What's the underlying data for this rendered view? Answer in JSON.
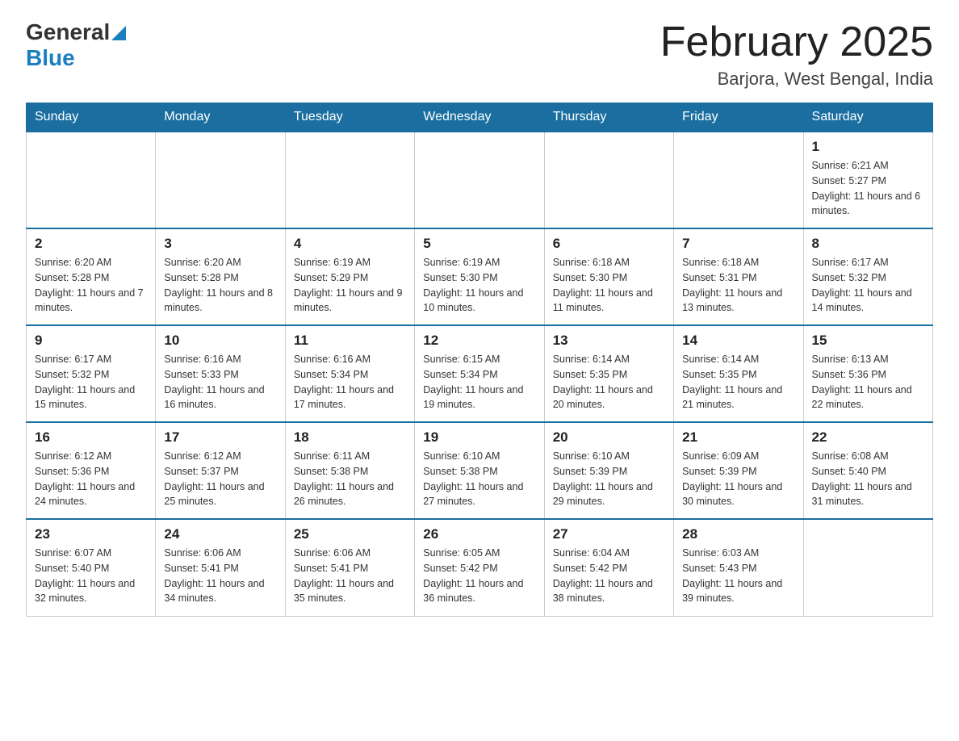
{
  "logo": {
    "general": "General",
    "blue": "Blue"
  },
  "title": "February 2025",
  "subtitle": "Barjora, West Bengal, India",
  "weekdays": [
    "Sunday",
    "Monday",
    "Tuesday",
    "Wednesday",
    "Thursday",
    "Friday",
    "Saturday"
  ],
  "weeks": [
    [
      {
        "day": "",
        "info": ""
      },
      {
        "day": "",
        "info": ""
      },
      {
        "day": "",
        "info": ""
      },
      {
        "day": "",
        "info": ""
      },
      {
        "day": "",
        "info": ""
      },
      {
        "day": "",
        "info": ""
      },
      {
        "day": "1",
        "info": "Sunrise: 6:21 AM\nSunset: 5:27 PM\nDaylight: 11 hours and 6 minutes."
      }
    ],
    [
      {
        "day": "2",
        "info": "Sunrise: 6:20 AM\nSunset: 5:28 PM\nDaylight: 11 hours and 7 minutes."
      },
      {
        "day": "3",
        "info": "Sunrise: 6:20 AM\nSunset: 5:28 PM\nDaylight: 11 hours and 8 minutes."
      },
      {
        "day": "4",
        "info": "Sunrise: 6:19 AM\nSunset: 5:29 PM\nDaylight: 11 hours and 9 minutes."
      },
      {
        "day": "5",
        "info": "Sunrise: 6:19 AM\nSunset: 5:30 PM\nDaylight: 11 hours and 10 minutes."
      },
      {
        "day": "6",
        "info": "Sunrise: 6:18 AM\nSunset: 5:30 PM\nDaylight: 11 hours and 11 minutes."
      },
      {
        "day": "7",
        "info": "Sunrise: 6:18 AM\nSunset: 5:31 PM\nDaylight: 11 hours and 13 minutes."
      },
      {
        "day": "8",
        "info": "Sunrise: 6:17 AM\nSunset: 5:32 PM\nDaylight: 11 hours and 14 minutes."
      }
    ],
    [
      {
        "day": "9",
        "info": "Sunrise: 6:17 AM\nSunset: 5:32 PM\nDaylight: 11 hours and 15 minutes."
      },
      {
        "day": "10",
        "info": "Sunrise: 6:16 AM\nSunset: 5:33 PM\nDaylight: 11 hours and 16 minutes."
      },
      {
        "day": "11",
        "info": "Sunrise: 6:16 AM\nSunset: 5:34 PM\nDaylight: 11 hours and 17 minutes."
      },
      {
        "day": "12",
        "info": "Sunrise: 6:15 AM\nSunset: 5:34 PM\nDaylight: 11 hours and 19 minutes."
      },
      {
        "day": "13",
        "info": "Sunrise: 6:14 AM\nSunset: 5:35 PM\nDaylight: 11 hours and 20 minutes."
      },
      {
        "day": "14",
        "info": "Sunrise: 6:14 AM\nSunset: 5:35 PM\nDaylight: 11 hours and 21 minutes."
      },
      {
        "day": "15",
        "info": "Sunrise: 6:13 AM\nSunset: 5:36 PM\nDaylight: 11 hours and 22 minutes."
      }
    ],
    [
      {
        "day": "16",
        "info": "Sunrise: 6:12 AM\nSunset: 5:36 PM\nDaylight: 11 hours and 24 minutes."
      },
      {
        "day": "17",
        "info": "Sunrise: 6:12 AM\nSunset: 5:37 PM\nDaylight: 11 hours and 25 minutes."
      },
      {
        "day": "18",
        "info": "Sunrise: 6:11 AM\nSunset: 5:38 PM\nDaylight: 11 hours and 26 minutes."
      },
      {
        "day": "19",
        "info": "Sunrise: 6:10 AM\nSunset: 5:38 PM\nDaylight: 11 hours and 27 minutes."
      },
      {
        "day": "20",
        "info": "Sunrise: 6:10 AM\nSunset: 5:39 PM\nDaylight: 11 hours and 29 minutes."
      },
      {
        "day": "21",
        "info": "Sunrise: 6:09 AM\nSunset: 5:39 PM\nDaylight: 11 hours and 30 minutes."
      },
      {
        "day": "22",
        "info": "Sunrise: 6:08 AM\nSunset: 5:40 PM\nDaylight: 11 hours and 31 minutes."
      }
    ],
    [
      {
        "day": "23",
        "info": "Sunrise: 6:07 AM\nSunset: 5:40 PM\nDaylight: 11 hours and 32 minutes."
      },
      {
        "day": "24",
        "info": "Sunrise: 6:06 AM\nSunset: 5:41 PM\nDaylight: 11 hours and 34 minutes."
      },
      {
        "day": "25",
        "info": "Sunrise: 6:06 AM\nSunset: 5:41 PM\nDaylight: 11 hours and 35 minutes."
      },
      {
        "day": "26",
        "info": "Sunrise: 6:05 AM\nSunset: 5:42 PM\nDaylight: 11 hours and 36 minutes."
      },
      {
        "day": "27",
        "info": "Sunrise: 6:04 AM\nSunset: 5:42 PM\nDaylight: 11 hours and 38 minutes."
      },
      {
        "day": "28",
        "info": "Sunrise: 6:03 AM\nSunset: 5:43 PM\nDaylight: 11 hours and 39 minutes."
      },
      {
        "day": "",
        "info": ""
      }
    ]
  ]
}
